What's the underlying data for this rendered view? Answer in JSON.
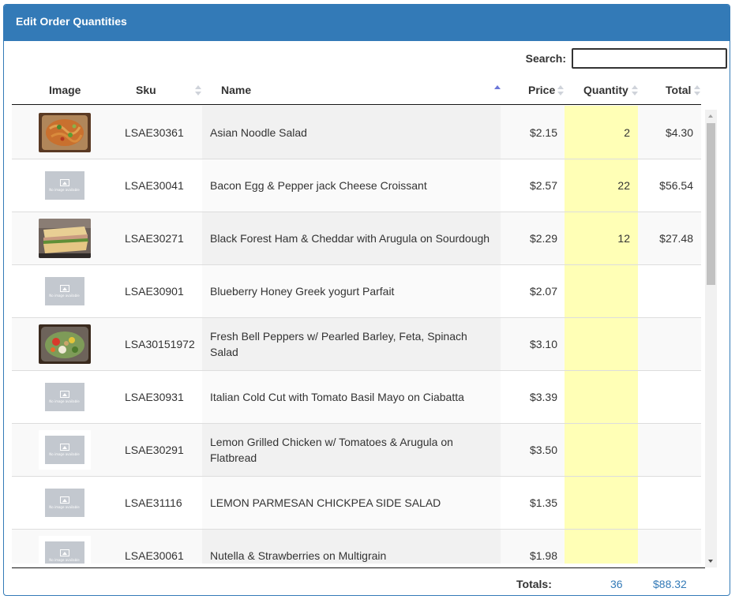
{
  "panel": {
    "title": "Edit Order Quantities"
  },
  "search": {
    "label": "Search:",
    "value": "",
    "placeholder": ""
  },
  "columns": {
    "image": "Image",
    "sku": "Sku",
    "name": "Name",
    "price": "Price",
    "quantity": "Quantity",
    "total": "Total"
  },
  "sort": {
    "column": "name",
    "direction": "ascending"
  },
  "rows": [
    {
      "image": "noodle-salad-photo",
      "sku": "LSAE30361",
      "name": "Asian Noodle Salad",
      "price": "$2.15",
      "quantity": "2",
      "total": "$4.30"
    },
    {
      "image": "no-image-available",
      "sku": "LSAE30041",
      "name": "Bacon Egg & Pepper jack Cheese Croissant",
      "price": "$2.57",
      "quantity": "22",
      "total": "$56.54"
    },
    {
      "image": "sandwich-photo",
      "sku": "LSAE30271",
      "name": "Black Forest Ham & Cheddar with Arugula on Sourdough",
      "price": "$2.29",
      "quantity": "12",
      "total": "$27.48"
    },
    {
      "image": "no-image-available",
      "sku": "LSAE30901",
      "name": "Blueberry Honey Greek yogurt Parfait",
      "price": "$2.07",
      "quantity": "",
      "total": ""
    },
    {
      "image": "salad-photo",
      "sku": "LSA30151972",
      "name": "Fresh Bell Peppers w/ Pearled Barley, Feta, Spinach Salad",
      "price": "$3.10",
      "quantity": "",
      "total": ""
    },
    {
      "image": "no-image-available",
      "sku": "LSAE30931",
      "name": "Italian Cold Cut with Tomato Basil Mayo on Ciabatta",
      "price": "$3.39",
      "quantity": "",
      "total": ""
    },
    {
      "image": "no-image-available",
      "sku": "LSAE30291",
      "name": "Lemon Grilled Chicken w/ Tomatoes & Arugula on Flatbread",
      "price": "$3.50",
      "quantity": "",
      "total": ""
    },
    {
      "image": "no-image-available",
      "sku": "LSAE31116",
      "name": "LEMON PARMESAN CHICKPEA SIDE SALAD",
      "price": "$1.35",
      "quantity": "",
      "total": ""
    },
    {
      "image": "no-image-available",
      "sku": "LSAE30061",
      "name": "Nutella & Strawberries on Multigrain",
      "price": "$1.98",
      "quantity": "",
      "total": ""
    }
  ],
  "no_image_text": "No image available",
  "totals": {
    "label": "Totals:",
    "quantity": "36",
    "amount": "$88.32"
  },
  "colors": {
    "header_bg": "#337ab7",
    "quantity_column_bg": "#ffffb6",
    "totals_text": "#337ab7",
    "sort_active": "#6b76d8"
  }
}
